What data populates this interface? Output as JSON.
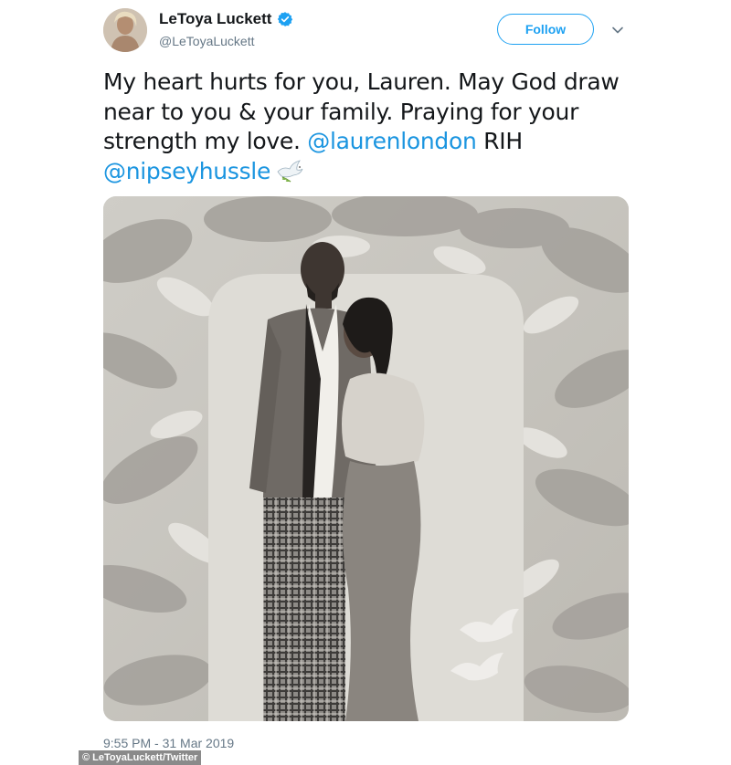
{
  "user": {
    "display_name": "LeToya Luckett",
    "handle": "@LeToyaLuckett",
    "verified_icon": "verified-badge-icon"
  },
  "actions": {
    "follow_label": "Follow",
    "more_icon": "chevron-down-icon"
  },
  "tweet": {
    "text_part1": "My heart hurts for you, Lauren. May God draw near to you & your family. Praying for your strength my love. ",
    "mention1": "@laurenlondon",
    "text_part2": " RIH ",
    "mention2": "@nipseyhussle",
    "emoji_icon": "dove-icon",
    "timestamp": "9:55 PM - 31 Mar 2019"
  },
  "media": {
    "photo_icon": "couple-photo"
  },
  "credit": "© LeToyaLuckett/Twitter",
  "colors": {
    "accent": "#1da1f2",
    "mention": "#1b95e0",
    "muted": "#657786",
    "text": "#14171a"
  }
}
